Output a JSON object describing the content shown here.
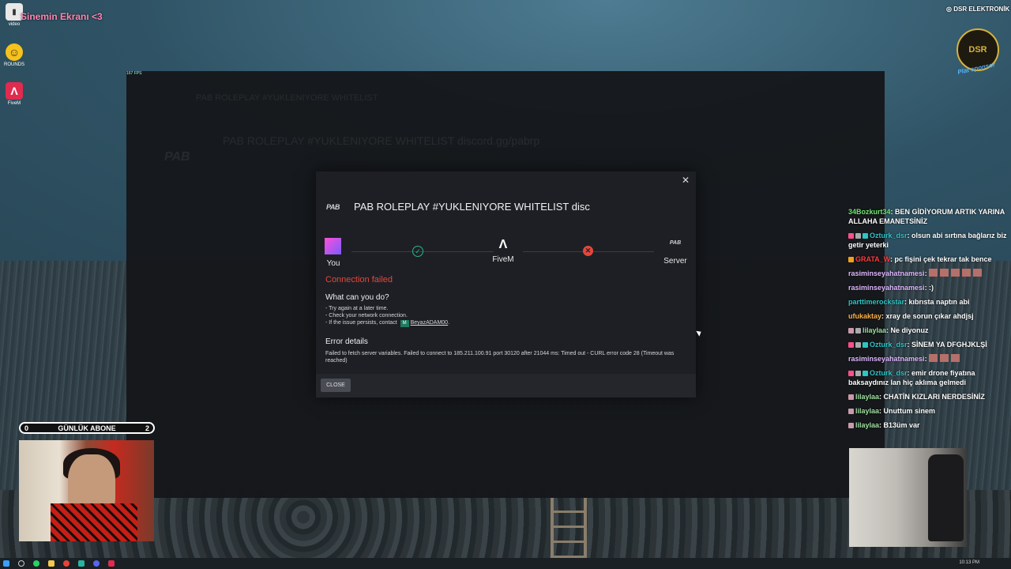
{
  "desktop": {
    "stream_title": "Sinemin Ekranı <3",
    "icons": [
      {
        "label": "video",
        "icon": "video-file-icon"
      },
      {
        "label": "ROUNDS",
        "icon": "rounds-icon"
      },
      {
        "label": "FiveM",
        "icon": "fivem-icon"
      }
    ],
    "fps_text": "167 FPS"
  },
  "fivem_bg": {
    "header_title": "PAB ROLEPLAY #YUKLENIYORE WHITELIST",
    "server_name": "PAB ROLEPLAY #YUKLENIYORE WHITELIST discord.gg/pabrp",
    "logo": "PAB"
  },
  "dialog": {
    "server_logo": "PAB",
    "title": "PAB ROLEPLAY #YUKLENIYORE WHITELIST disc",
    "close_icon": "close-icon",
    "nodes": {
      "you": "You",
      "fivem": "FiveM",
      "server": "Server"
    },
    "status": "Connection failed",
    "what_title": "What can you do?",
    "tips": [
      "- Try again at a later time.",
      "- Check your network connection.",
      "- If the issue persists, contact"
    ],
    "contact_badge": "M",
    "contact_name": "BeyazADAM00",
    "contact_suffix": ".",
    "error_title": "Error details",
    "error_text": "Failed to fetch server variables. Failed to connect to 185.211.100.91 port 30120 after 21044 ms: Timed out - CURL error code 28 (Timeout was reached)",
    "close_button": "CLOSE",
    "colors": {
      "ok": "#29b58a",
      "fail": "#e5473c"
    }
  },
  "sponsor": {
    "handle": "DSR ELEKTRONİK",
    "badge": "DSR",
    "tag": "Plat sponsor"
  },
  "sub_counter": {
    "left": "0",
    "label": "GÜNLÜK ABONE",
    "right": "2"
  },
  "chat": [
    {
      "user": "34Bozkurt34",
      "color": "#6fe36f",
      "text": ": BEN GİDİYORUM ARTIK YARINA ALLAHA EMANETSİNİZ",
      "badges": []
    },
    {
      "user": "Ozturk_dsr",
      "color": "#2ec5c5",
      "text": ": olsun abi sırtına bağlarız biz getir yeterki",
      "badges": [
        "#ff4f8a",
        "#aaa",
        "#2ec5c5"
      ]
    },
    {
      "user": "GRATA_W",
      "color": "#ff3b3b",
      "text": ": pc fişini çek tekrar tak bence",
      "badges": [
        "#f0a020"
      ]
    },
    {
      "user": "rasiminseyahatnamesi",
      "color": "#e0b8ff",
      "text": ":",
      "badges": [],
      "emotes": 5
    },
    {
      "user": "rasiminseyahatnamesi",
      "color": "#e0b8ff",
      "text": ": :)",
      "badges": []
    },
    {
      "user": "parttimerockstar",
      "color": "#2ec5c5",
      "text": ": kıbrısta naptın abi",
      "badges": []
    },
    {
      "user": "ufukaktay",
      "color": "#ffb347",
      "text": ": xray de sorun çıkar ahdjsj",
      "badges": []
    },
    {
      "user": "lilaylaa",
      "color": "#9fe09f",
      "text": ": Ne diyonuz",
      "badges": [
        "#c9a",
        "#aaa"
      ]
    },
    {
      "user": "Ozturk_dsr",
      "color": "#2ec5c5",
      "text": ": SİNEM YA DFGHJKLŞİ",
      "badges": [
        "#ff4f8a",
        "#aaa",
        "#2ec5c5"
      ]
    },
    {
      "user": "rasiminseyahatnamesi",
      "color": "#e0b8ff",
      "text": ":",
      "badges": [],
      "emotes": 3
    },
    {
      "user": "Ozturk_dsr",
      "color": "#2ec5c5",
      "text": ": emir drone fiyatına baksaydınız lan hiç aklıma gelmedi",
      "badges": [
        "#ff4f8a",
        "#aaa",
        "#2ec5c5"
      ]
    },
    {
      "user": "lilaylaa",
      "color": "#9fe09f",
      "text": ": CHATİN KIZLARI NERDESİNİZ",
      "badges": [
        "#c9a"
      ]
    },
    {
      "user": "lilaylaa",
      "color": "#9fe09f",
      "text": ": Unuttum sinem",
      "badges": [
        "#c9a"
      ]
    },
    {
      "user": "lilaylaa",
      "color": "#9fe09f",
      "text": ": B13üm var",
      "badges": [
        "#c9a"
      ]
    }
  ],
  "taskbar": {
    "clock": "10:13 PM",
    "apps": [
      "windows-start-icon",
      "search-icon",
      "whatsapp-icon",
      "file-explorer-icon",
      "chrome-icon",
      "app-icon",
      "discord-icon",
      "steam-icon",
      "fivem-icon"
    ]
  }
}
